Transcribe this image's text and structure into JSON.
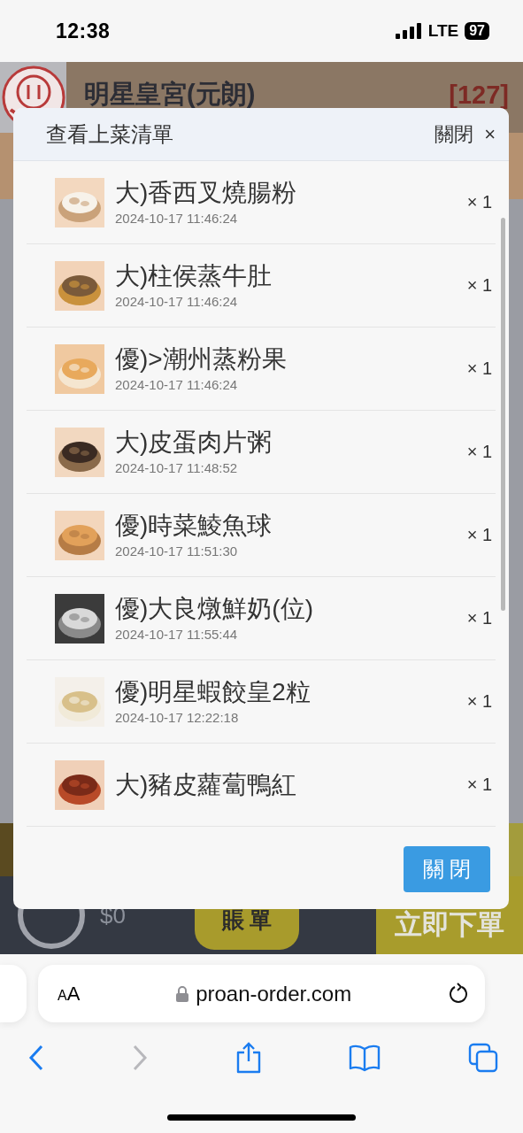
{
  "status_bar": {
    "time": "12:38",
    "network": "LTE",
    "battery": "97"
  },
  "restaurant": {
    "name": "明星皇宮(元朗)",
    "table": "[127]"
  },
  "bottom_bar": {
    "total": "$0",
    "bill_button": "賬 單",
    "order_button": "立即下單"
  },
  "dialog": {
    "title": "查看上菜清單",
    "close_label": "關閉",
    "close_icon": "×",
    "close_button": "關 閉",
    "items": [
      {
        "name": "大)香西叉燒腸粉",
        "time": "2024-10-17 11:46:24",
        "quantity": "× 1"
      },
      {
        "name": "大)柱侯蒸牛肚",
        "time": "2024-10-17 11:46:24",
        "quantity": "× 1"
      },
      {
        "name": "優)>潮州蒸粉果",
        "time": "2024-10-17 11:46:24",
        "quantity": "× 1"
      },
      {
        "name": "大)皮蛋肉片粥",
        "time": "2024-10-17 11:48:52",
        "quantity": "× 1"
      },
      {
        "name": "優)時菜鯪魚球",
        "time": "2024-10-17 11:51:30",
        "quantity": "× 1"
      },
      {
        "name": "優)大良燉鮮奶(位)",
        "time": "2024-10-17 11:55:44",
        "quantity": "× 1"
      },
      {
        "name": "優)明星蝦餃皇2粒",
        "time": "2024-10-17 12:22:18",
        "quantity": "× 1"
      },
      {
        "name": "大)豬皮蘿蔔鴨紅",
        "quantity": "× 1"
      }
    ]
  },
  "browser": {
    "text_size_button": "AA",
    "url": "proan-order.com",
    "forward_disabled": true
  }
}
